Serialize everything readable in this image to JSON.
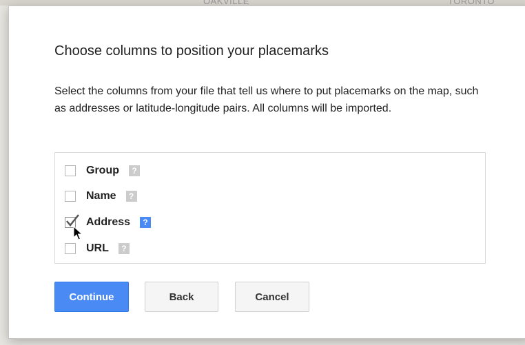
{
  "background_map": {
    "labels": [
      "OAKVILLE",
      "TORONTO"
    ]
  },
  "dialog": {
    "title": "Choose columns to position your placemarks",
    "description": "Select the columns from your file that tell us where to put placemarks on the map, such as addresses or latitude-longitude pairs. All columns will be imported.",
    "columns": [
      {
        "label": "Group",
        "checked": false,
        "help_icon": "question-icon"
      },
      {
        "label": "Name",
        "checked": false,
        "help_icon": "question-icon"
      },
      {
        "label": "Address",
        "checked": true,
        "help_icon": "question-icon",
        "help_active": true
      },
      {
        "label": "URL",
        "checked": false,
        "help_icon": "question-icon"
      }
    ],
    "help_glyph": "?",
    "buttons": {
      "continue": "Continue",
      "back": "Back",
      "cancel": "Cancel"
    }
  },
  "colors": {
    "primary": "#4a8af4",
    "help_inactive": "#cccccc",
    "text": "#222222"
  }
}
